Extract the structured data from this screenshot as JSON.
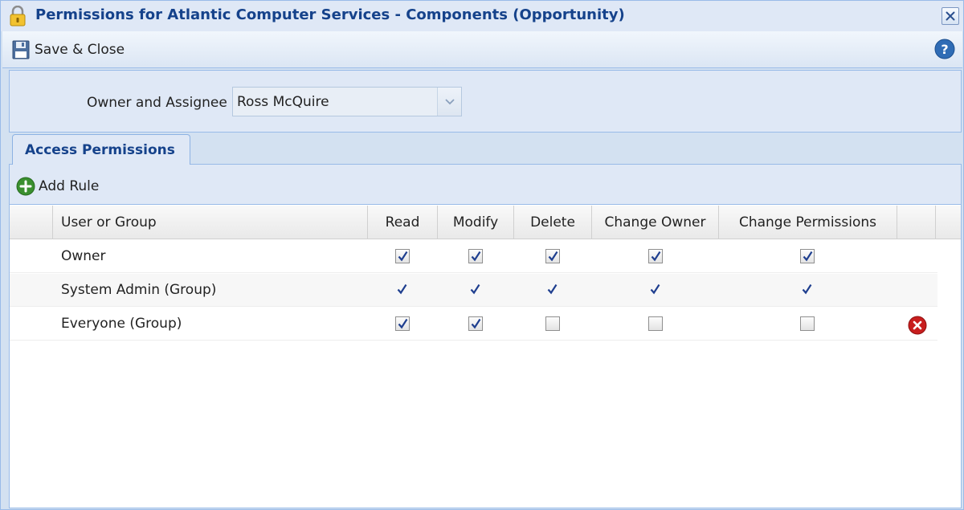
{
  "window": {
    "title": "Permissions for Atlantic Computer Services - Components (Opportunity)"
  },
  "toolbar": {
    "save_close_label": "Save & Close"
  },
  "owner": {
    "label": "Owner and Assignee",
    "value": "Ross McQuire"
  },
  "tabs": [
    {
      "label": "Access Permissions",
      "active": true
    }
  ],
  "grid": {
    "add_rule_label": "Add Rule",
    "columns": [
      "User or Group",
      "Read",
      "Modify",
      "Delete",
      "Change Owner",
      "Change Permissions"
    ],
    "rows": [
      {
        "name": "Owner",
        "style": "boxed",
        "read": true,
        "modify": true,
        "delete": true,
        "change_owner": true,
        "change_permissions": true,
        "deletable": false
      },
      {
        "name": "System Admin (Group)",
        "style": "plain",
        "read": true,
        "modify": true,
        "delete": true,
        "change_owner": true,
        "change_permissions": true,
        "deletable": false
      },
      {
        "name": "Everyone (Group)",
        "style": "boxed",
        "read": true,
        "modify": true,
        "delete": false,
        "change_owner": false,
        "change_permissions": false,
        "deletable": true
      }
    ]
  },
  "icons": {
    "lock": "lock-icon",
    "close": "close-icon",
    "save": "floppy-disk-icon",
    "help": "help-icon",
    "add": "add-icon",
    "delete": "delete-icon",
    "check": "checkmark-icon"
  },
  "colors": {
    "title_text": "#15428b",
    "panel_bg": "#dfe8f6",
    "border": "#99bbe8",
    "check": "#1f3f8f",
    "add_green": "#3a8f2f",
    "delete_red": "#c81e1e"
  }
}
